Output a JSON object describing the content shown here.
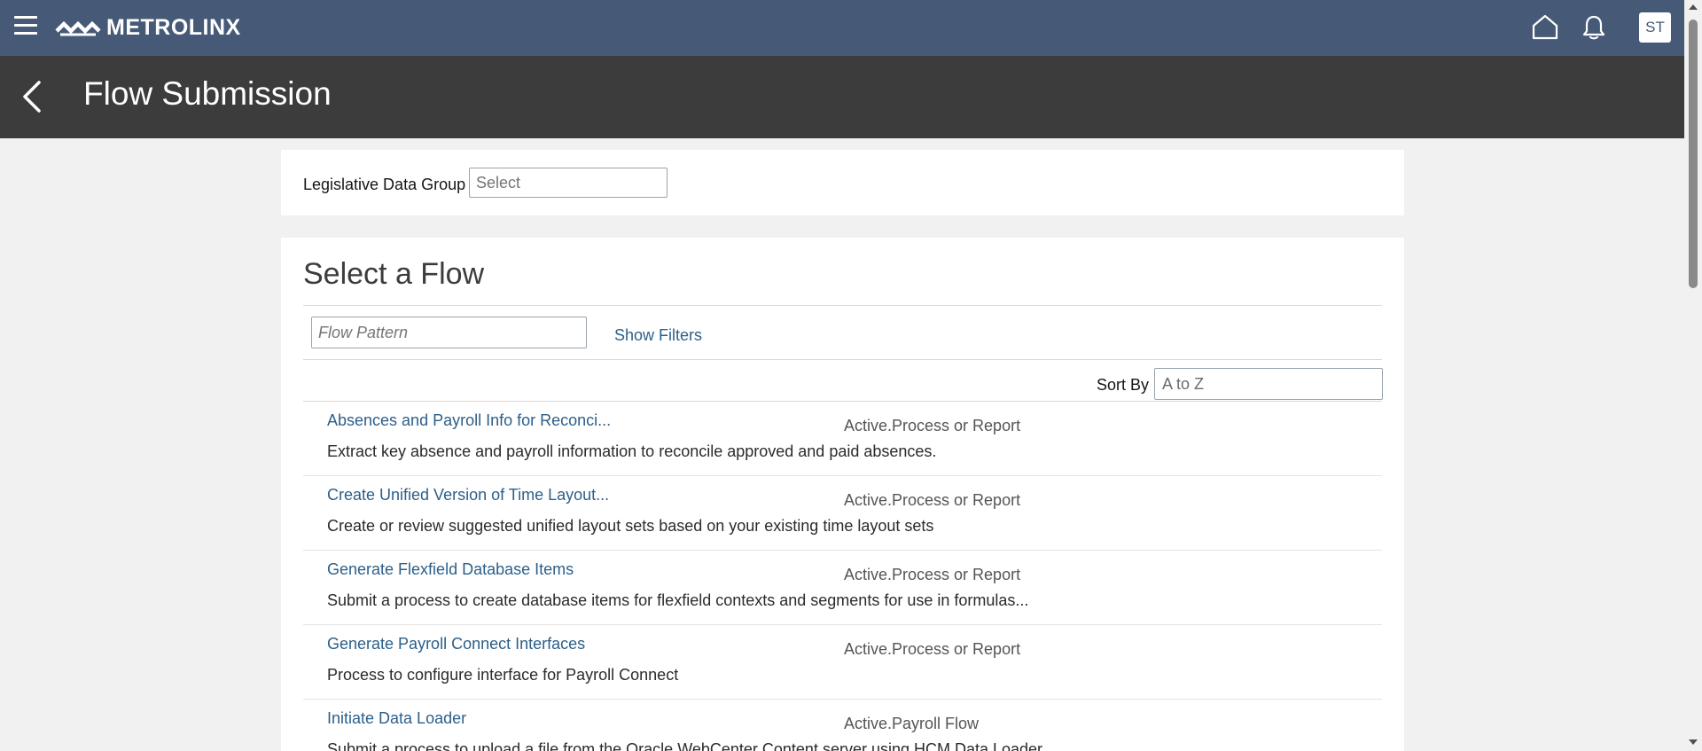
{
  "header": {
    "brand": "METROLINX",
    "avatar_initials": "ST",
    "colors": {
      "bar": "#465a78",
      "title_bar": "#3c3c3c",
      "link": "#2c5f8a"
    }
  },
  "title": {
    "text": "Flow Submission"
  },
  "ldg": {
    "label": "Legislative Data Group",
    "placeholder": "Select"
  },
  "flow": {
    "heading": "Select a Flow",
    "pattern_placeholder": "Flow Pattern",
    "show_filters": "Show Filters",
    "sort_label": "Sort By",
    "sort_value": "A to Z",
    "items": [
      {
        "name": "Absences and Payroll Info for Reconci...",
        "status": "Active.Process or Report",
        "description": "Extract key absence and payroll information to reconcile approved and paid absences."
      },
      {
        "name": "Create Unified Version of Time Layout...",
        "status": "Active.Process or Report",
        "description": "Create or review suggested unified layout sets based on your existing time layout sets"
      },
      {
        "name": "Generate Flexfield Database Items",
        "status": "Active.Process or Report",
        "description": "Submit a process to create database items for flexfield contexts and segments for use in formulas..."
      },
      {
        "name": "Generate Payroll Connect Interfaces",
        "status": "Active.Process or Report",
        "description": "Process to configure interface for Payroll Connect"
      },
      {
        "name": "Initiate Data Loader",
        "status": "Active.Payroll Flow",
        "description": "Submit a process to upload a file from the Oracle WebCenter Content server using HCM Data Loader"
      }
    ]
  }
}
